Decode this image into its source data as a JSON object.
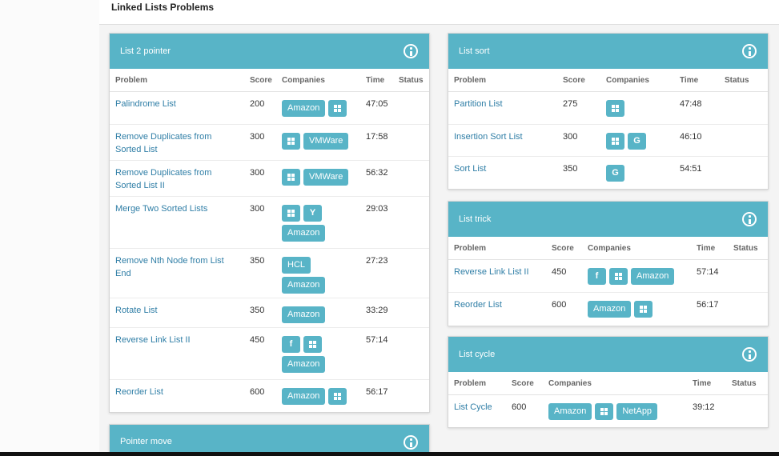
{
  "page": {
    "title": "Linked Lists Problems"
  },
  "columns": {
    "problem": "Problem",
    "score": "Score",
    "companies": "Companies",
    "time": "Time",
    "status": "Status"
  },
  "cards": {
    "list_2_pointer": {
      "title": "List 2 pointer",
      "rows": [
        {
          "name": "Palindrome List",
          "score": "200",
          "time": "47:05",
          "companies": [
            {
              "label": "Amazon"
            },
            {
              "icon": "windows"
            }
          ]
        },
        {
          "name": "Remove Duplicates from Sorted List",
          "score": "300",
          "time": "17:58",
          "companies": [
            {
              "icon": "windows"
            },
            {
              "label": "VMWare"
            }
          ]
        },
        {
          "name": "Remove Duplicates from Sorted List II",
          "score": "300",
          "time": "56:32",
          "companies": [
            {
              "icon": "windows"
            },
            {
              "label": "VMWare"
            }
          ]
        },
        {
          "name": "Merge Two Sorted Lists",
          "score": "300",
          "time": "29:03",
          "companies": [
            {
              "icon": "windows"
            },
            {
              "icon": "yahoo",
              "glyph": "Y"
            },
            {
              "label": "Amazon"
            }
          ]
        },
        {
          "name": "Remove Nth Node from List End",
          "score": "350",
          "time": "27:23",
          "companies": [
            {
              "label": "HCL"
            },
            {
              "label": "Amazon"
            }
          ]
        },
        {
          "name": "Rotate List",
          "score": "350",
          "time": "33:29",
          "companies": [
            {
              "label": "Amazon"
            }
          ]
        },
        {
          "name": "Reverse Link List II",
          "score": "450",
          "time": "57:14",
          "companies": [
            {
              "icon": "facebook",
              "glyph": "f"
            },
            {
              "icon": "windows"
            },
            {
              "label": "Amazon"
            }
          ]
        },
        {
          "name": "Reorder List",
          "score": "600",
          "time": "56:17",
          "companies": [
            {
              "label": "Amazon"
            },
            {
              "icon": "windows"
            }
          ]
        }
      ]
    },
    "pointer_move": {
      "title": "Pointer move"
    },
    "list_sort": {
      "title": "List sort",
      "rows": [
        {
          "name": "Partition List",
          "score": "275",
          "time": "47:48",
          "companies": [
            {
              "icon": "windows"
            }
          ]
        },
        {
          "name": "Insertion Sort List",
          "score": "300",
          "time": "46:10",
          "companies": [
            {
              "icon": "windows"
            },
            {
              "icon": "google",
              "glyph": "G"
            }
          ]
        },
        {
          "name": "Sort List",
          "score": "350",
          "time": "54:51",
          "companies": [
            {
              "icon": "google",
              "glyph": "G"
            }
          ]
        }
      ]
    },
    "list_trick": {
      "title": "List trick",
      "rows": [
        {
          "name": "Reverse Link List II",
          "score": "450",
          "time": "57:14",
          "companies": [
            {
              "icon": "facebook",
              "glyph": "f"
            },
            {
              "icon": "windows"
            },
            {
              "label": "Amazon"
            }
          ]
        },
        {
          "name": "Reorder List",
          "score": "600",
          "time": "56:17",
          "companies": [
            {
              "label": "Amazon"
            },
            {
              "icon": "windows"
            }
          ]
        }
      ]
    },
    "list_cycle": {
      "title": "List cycle",
      "rows": [
        {
          "name": "List Cycle",
          "score": "600",
          "time": "39:12",
          "companies": [
            {
              "label": "Amazon"
            },
            {
              "icon": "windows"
            },
            {
              "label": "NetApp"
            }
          ]
        }
      ]
    }
  },
  "colors": {
    "accent": "#58b4c7",
    "link": "#2f7ea6"
  }
}
